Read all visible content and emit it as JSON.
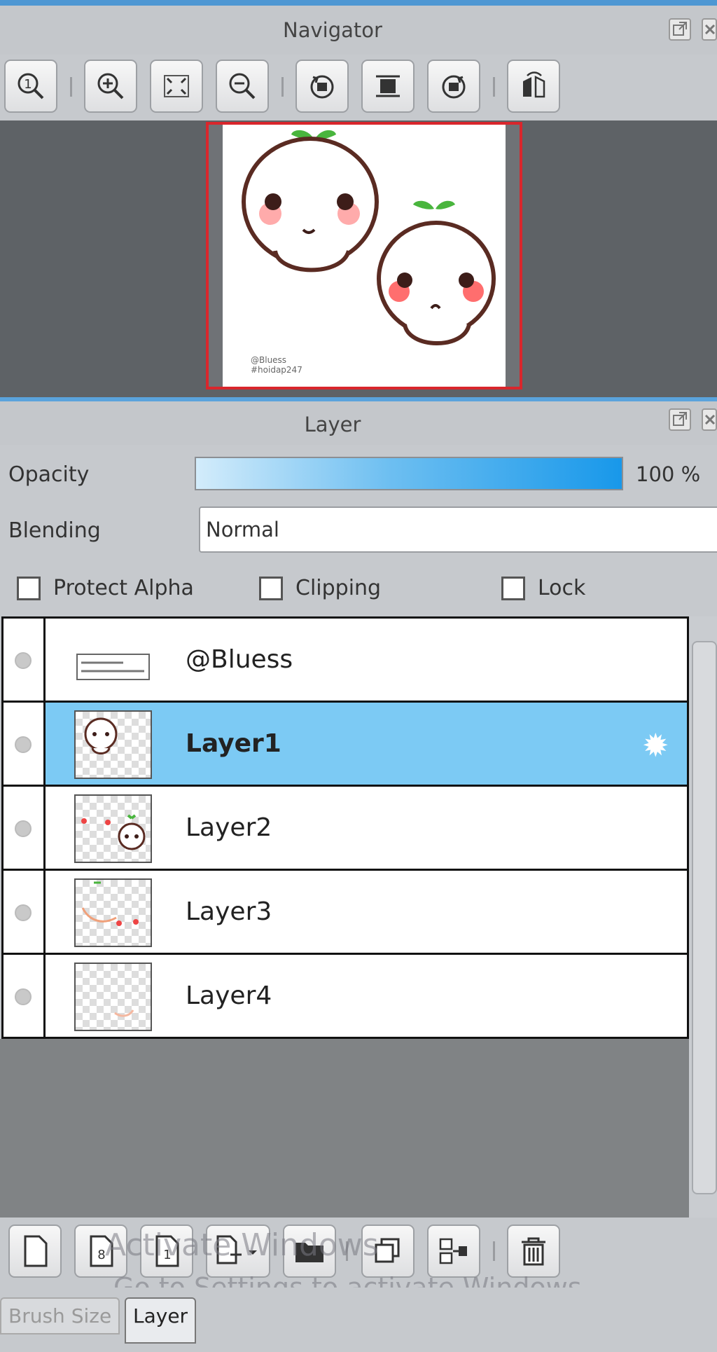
{
  "navigator": {
    "title": "Navigator",
    "toolbar": [
      "zoom-actual-icon",
      "zoom-in-icon",
      "fit-window-icon",
      "zoom-out-icon",
      "rotate-left-icon",
      "fit-canvas-icon",
      "rotate-right-icon",
      "flip-horizontal-icon"
    ]
  },
  "layer_panel": {
    "title": "Layer",
    "opacity_label": "Opacity",
    "opacity_value_text": "100 %",
    "opacity_fraction": 1.0,
    "blending_label": "Blending",
    "blending_value": "Normal",
    "checkboxes": {
      "protect_alpha": "Protect Alpha",
      "clipping": "Clipping",
      "lock": "Lock"
    },
    "layers": [
      {
        "name": "@Bluess",
        "selected": false
      },
      {
        "name": "Layer1",
        "selected": true
      },
      {
        "name": "Layer2",
        "selected": false
      },
      {
        "name": "Layer3",
        "selected": false
      },
      {
        "name": "Layer4",
        "selected": false
      }
    ],
    "bottom_toolbar": [
      "new-layer-icon",
      "new-8bit-layer-icon",
      "new-1bit-layer-icon",
      "add-layer-menu-icon",
      "new-folder-icon",
      "duplicate-layer-icon",
      "merge-down-icon",
      "delete-layer-icon"
    ]
  },
  "watermark": {
    "line1": "Activate Windows",
    "line2": "Go to Settings to activate Windows."
  },
  "tabs": {
    "brush_size": "Brush Size",
    "layer": "Layer"
  }
}
